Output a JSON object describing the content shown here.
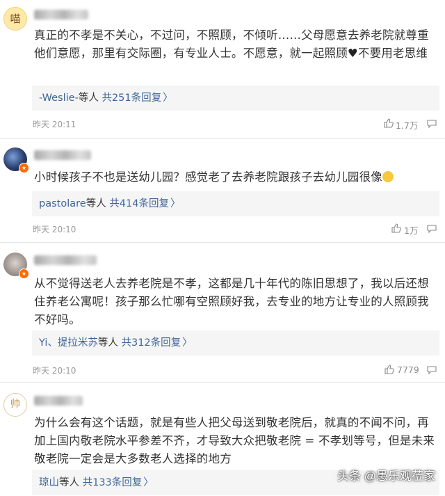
{
  "comments": [
    {
      "avatar_text": "喵",
      "text": "真正的不孝是不关心，不过问，不照顾，不倾听……父母愿意去养老院就尊重他们意愿，那里有交际圈，有专业人士。不愿意，就一起照顾",
      "text_tail": "不要用老思维",
      "reply_name": "-Weslie-",
      "reply_mid": "等人",
      "reply_count": "共251条回复",
      "time": "昨天 20:11",
      "likes": "1.7万"
    },
    {
      "text": "小时候孩子不也是送幼儿园？感觉老了去养老院跟孩子去幼儿园很像",
      "reply_name": "pastolare",
      "reply_mid": "等人",
      "reply_count": "共414条回复",
      "time": "昨天 20:10",
      "likes": "1万"
    },
    {
      "text": "从不觉得送老人去养老院是不孝，这都是几十年代的陈旧思想了，我以后还想住养老公寓呢！孩子那么忙哪有空照顾好我，去专业的地方让专业的人照顾我不好吗。",
      "reply_name": "Yi、提拉米苏",
      "reply_mid": "等人",
      "reply_count": "共312条回复",
      "time": "昨天 20:10",
      "likes": "7779"
    },
    {
      "avatar_text": "帅",
      "text": "为什么会有这个话题，就是有些人把父母送到敬老院后，就真的不闻不问，再加上国内敬老院水平参差不齐，才导致大众把敬老院 = 不孝划等号，但是未来敬老院一定会是大多数老人选择的地方",
      "reply_name": "琼山",
      "reply_mid": "等人",
      "reply_count": "共133条回复",
      "time": "",
      "likes": ""
    }
  ],
  "reply_arrow": "〉",
  "watermark": "头条 @愚乐观莅家",
  "colors": {
    "link": "#406599",
    "reply_bg": "#f5f5f5",
    "divider": "#e6e6e6",
    "meta": "#999999"
  }
}
